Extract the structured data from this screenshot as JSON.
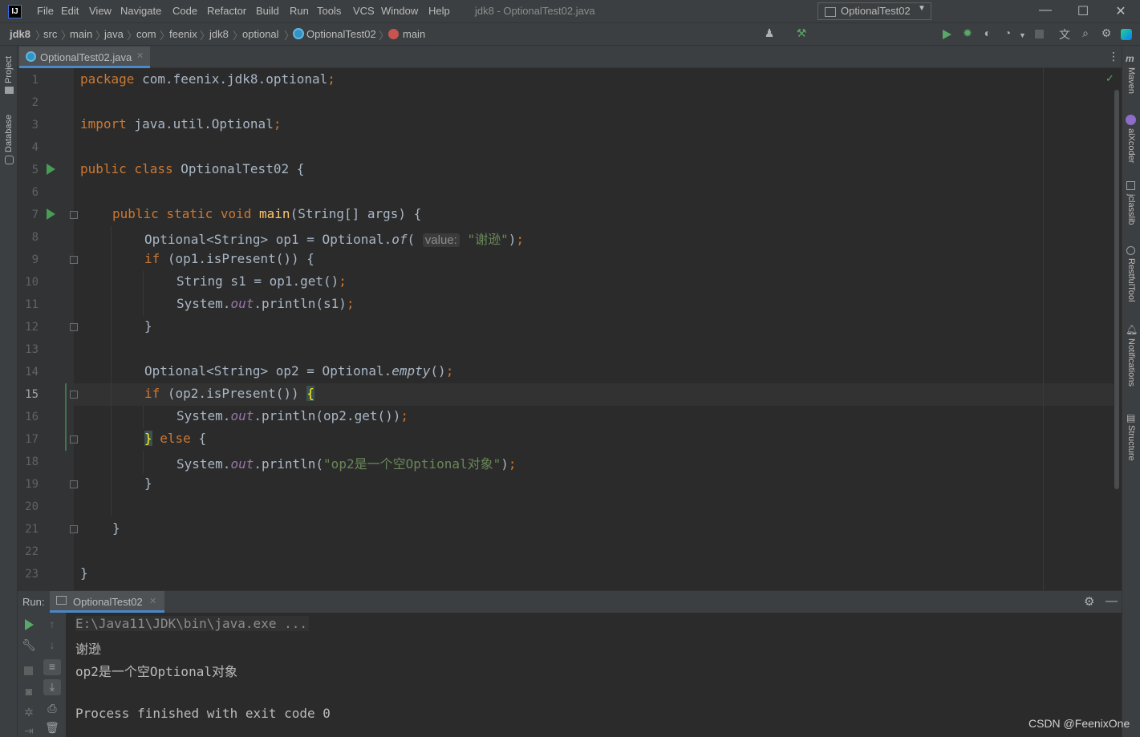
{
  "titlebar": {
    "logo": "IJ",
    "menu": [
      "File",
      "Edit",
      "View",
      "Navigate",
      "Code",
      "Refactor",
      "Build",
      "Run",
      "Tools",
      "VCS",
      "Window",
      "Help"
    ],
    "window_title": "jdk8 - OptionalTest02.java",
    "controls": [
      "—",
      "☐",
      "✕"
    ]
  },
  "breadcrumbs": [
    "jdk8",
    "src",
    "main",
    "java",
    "com",
    "feenix",
    "jdk8",
    "optional",
    "OptionalTest02",
    "main"
  ],
  "toolbar": {
    "run_config": "OptionalTest02"
  },
  "left_sidebar": {
    "project": "Project",
    "database": "Database"
  },
  "right_sidebar": [
    "Maven",
    "aiXcoder",
    "jclasslib",
    "RestfulTool",
    "Notifications",
    "Structure"
  ],
  "editor_tab": {
    "label": "OptionalTest02.java"
  },
  "code_lines": [
    {
      "n": "1"
    },
    {
      "n": "2"
    },
    {
      "n": "3"
    },
    {
      "n": "4"
    },
    {
      "n": "5"
    },
    {
      "n": "6"
    },
    {
      "n": "7"
    },
    {
      "n": "8"
    },
    {
      "n": "9"
    },
    {
      "n": "10"
    },
    {
      "n": "11"
    },
    {
      "n": "12"
    },
    {
      "n": "13"
    },
    {
      "n": "14"
    },
    {
      "n": "15"
    },
    {
      "n": "16"
    },
    {
      "n": "17"
    },
    {
      "n": "18"
    },
    {
      "n": "19"
    },
    {
      "n": "20"
    },
    {
      "n": "21"
    },
    {
      "n": "22"
    },
    {
      "n": "23"
    }
  ],
  "code": {
    "l1_kw": "package",
    "l1_rest": " com.feenix.jdk8.optional",
    "semi": ";",
    "l3_kw": "import",
    "l3_rest": " java.util.Optional",
    "l5_kw": "public class",
    "l5_rest": " OptionalTest02 {",
    "l7_kw": "public static void",
    "l7_fn": "main",
    "l7_rest": "(String[] args) {",
    "l8_a": "Optional<String> op1 = Optional.",
    "l8_of": "of",
    "l8_paren": "(",
    "l8_hint": "value:",
    "l8_str": "\"谢逊\"",
    "l8_end": ")",
    "l9_kw": "if",
    "l9_rest": " (op1.isPresent()) {",
    "l10": "String s1 = op1.get()",
    "l11_a": "System.",
    "out": "out",
    "l11_b": ".println(s1)",
    "l12": "}",
    "l14_a": "Optional<String> op2 = Optional.",
    "l14_empty": "empty",
    "l14_b": "()",
    "l15_kw": "if",
    "l15_rest": " (op2.isPresent()) ",
    "l15_brace": "{",
    "l16_b": ".println(op2.get())",
    "l17_brace": "}",
    "l17_kw": " else",
    "l17_rest": " {",
    "l18_b": ".println(",
    "l18_str": "\"op2是一个空Optional对象\"",
    "l18_end": ")",
    "l19": "}",
    "l21": "}",
    "l23": "}"
  },
  "run_panel": {
    "label": "Run:",
    "tab": "OptionalTest02",
    "output": [
      "E:\\Java11\\JDK\\bin\\java.exe ...",
      "谢逊",
      "op2是一个空Optional对象",
      "",
      "Process finished with exit code 0"
    ]
  },
  "watermark": "CSDN @FeenixOne"
}
